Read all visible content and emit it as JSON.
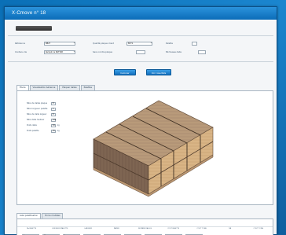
{
  "window": {
    "title": "X-Cmove n° 18"
  },
  "form": {
    "ref_label": "Référence",
    "ref_value": "BB27",
    "contenu_label": "Contenu de",
    "contenu_value": "Remplir le BATTAB",
    "qualite_label": "Qualité plaque client",
    "qualite_value": "BCT1",
    "sens_label": "Sens contre plaque",
    "sens_value": "",
    "palette_label": "Palette",
    "palette_value": "",
    "nb_label": "Nb fausse dalle",
    "nb_value": ""
  },
  "buttons": {
    "calculer": "Calculer",
    "voir_resultats": "Voir résultats"
  },
  "tabs": [
    "Etude",
    "Visualisation Aérienne",
    "Plaquer dalles",
    "Palettes"
  ],
  "params": [
    {
      "label": "Nbre de dalles plaque",
      "value": "8",
      "unit": ""
    },
    {
      "label": "Nbre longueur palette",
      "value": "4",
      "unit": ""
    },
    {
      "label": "Nbre de dalle largeur",
      "value": "8",
      "unit": ""
    },
    {
      "label": "Nbre dalle hauteur",
      "value": "100",
      "unit": ""
    },
    {
      "label": "Poids dalle",
      "value": "10",
      "unit": "kg"
    },
    {
      "label": "Poids palette",
      "value": "25",
      "unit": "kg"
    }
  ],
  "bottom_tabs": [
    "Liste palettisation",
    "Ecrire modèles"
  ],
  "grid": {
    "headers": [
      "Nb PALETTE",
      "LONGUEUR PALETTE",
      "LARGEUR",
      "PAPIER",
      "NOMBRE DALLES",
      "COUT PALETTE",
      "COUT TOTAL",
      "NB",
      "COUT TOTAL"
    ],
    "row": [
      "1",
      "11",
      "1",
      "",
      "",
      "",
      "",
      "",
      ""
    ]
  }
}
